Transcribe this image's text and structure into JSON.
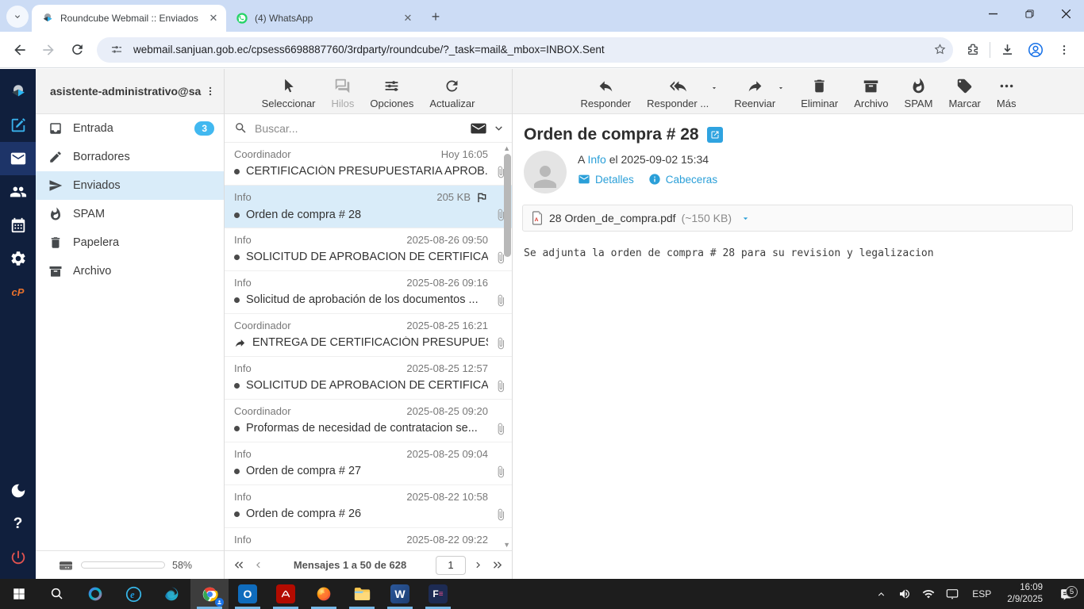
{
  "browser": {
    "tabs": [
      {
        "title": "Roundcube Webmail :: Enviados",
        "favicon": "roundcube",
        "active": true
      },
      {
        "title": "(4) WhatsApp",
        "favicon": "whatsapp",
        "active": false
      }
    ],
    "url": "webmail.sanjuan.gob.ec/cpsess6698887760/3rdparty/roundcube/?_task=mail&_mbox=INBOX.Sent"
  },
  "rail": {
    "items": [
      {
        "name": "roundcube-logo",
        "icon": "logo"
      },
      {
        "name": "compose",
        "icon": "pencil-square",
        "style": "compose"
      },
      {
        "name": "mail",
        "icon": "envelope",
        "active": true
      },
      {
        "name": "contacts",
        "icon": "people"
      },
      {
        "name": "calendar",
        "icon": "calendar"
      },
      {
        "name": "settings",
        "icon": "gear"
      },
      {
        "name": "cpanel",
        "icon": "cp-text",
        "style": "cpanel",
        "text": "cP"
      },
      {
        "name": "spacer"
      },
      {
        "name": "dark-mode",
        "icon": "moon"
      },
      {
        "name": "help",
        "icon": "question"
      },
      {
        "name": "logout",
        "icon": "power",
        "style": "logout"
      }
    ]
  },
  "sidebar": {
    "account": "asistente-administrativo@sa...",
    "folders": [
      {
        "label": "Entrada",
        "icon": "inbox",
        "badge": "3"
      },
      {
        "label": "Borradores",
        "icon": "pencil"
      },
      {
        "label": "Enviados",
        "icon": "send",
        "selected": true
      },
      {
        "label": "SPAM",
        "icon": "fire"
      },
      {
        "label": "Papelera",
        "icon": "trash"
      },
      {
        "label": "Archivo",
        "icon": "archivebox"
      }
    ],
    "storage_percent_label": "58%",
    "storage_percent_value": 58
  },
  "list_toolbar": {
    "buttons": [
      {
        "label": "Seleccionar",
        "icon": "cursor"
      },
      {
        "label": "Hilos",
        "icon": "threads",
        "disabled": true
      },
      {
        "label": "Opciones",
        "icon": "sliders"
      },
      {
        "label": "Actualizar",
        "icon": "refresh"
      }
    ],
    "search_placeholder": "Buscar..."
  },
  "message_list": {
    "messages": [
      {
        "sender": "Coordinador",
        "date": "Hoy 16:05",
        "subject": "CERTIFICACIÓN PRESUPUESTARIA APROB...",
        "attachment": true,
        "marker": "dot"
      },
      {
        "sender": "Info",
        "date": "205 KB",
        "subject": "Orden de compra # 28",
        "attachment": true,
        "marker": "dot",
        "selected": true,
        "flag": true
      },
      {
        "sender": "Info",
        "date": "2025-08-26 09:50",
        "subject": "SOLICITUD DE APROBACION DE CERTIFICA...",
        "attachment": true,
        "marker": "dot"
      },
      {
        "sender": "Info",
        "date": "2025-08-26 09:16",
        "subject": "Solicitud de aprobación de los documentos ...",
        "attachment": true,
        "marker": "dot"
      },
      {
        "sender": "Coordinador",
        "date": "2025-08-25 16:21",
        "subject": "ENTREGA DE CERTIFICACIÓN PRESUPUEST...",
        "attachment": true,
        "marker": "forward"
      },
      {
        "sender": "Info",
        "date": "2025-08-25 12:57",
        "subject": "SOLICITUD DE APROBACION DE CERTIFICA...",
        "attachment": true,
        "marker": "dot"
      },
      {
        "sender": "Coordinador",
        "date": "2025-08-25 09:20",
        "subject": "Proformas de necesidad de contratacion se...",
        "attachment": true,
        "marker": "dot"
      },
      {
        "sender": "Info",
        "date": "2025-08-25 09:04",
        "subject": "Orden de compra # 27",
        "attachment": true,
        "marker": "dot"
      },
      {
        "sender": "Info",
        "date": "2025-08-22 10:58",
        "subject": "Orden de compra # 26",
        "attachment": true,
        "marker": "dot"
      },
      {
        "sender": "Info",
        "date": "2025-08-22 09:22",
        "subject": "",
        "attachment": false,
        "marker": "none"
      }
    ],
    "pagination_text": "Mensajes 1 a 50 de 628",
    "page_value": "1"
  },
  "content": {
    "toolbar": [
      {
        "label": "Responder",
        "icon": "reply"
      },
      {
        "label": "Responder ...",
        "icon": "replyall",
        "caret": true
      },
      {
        "label": "Reenviar",
        "icon": "forward",
        "caret": true
      },
      {
        "label": "Eliminar",
        "icon": "trash"
      },
      {
        "label": "Archivo",
        "icon": "archivebox"
      },
      {
        "label": "SPAM",
        "icon": "fire"
      },
      {
        "label": "Marcar",
        "icon": "tag"
      },
      {
        "label": "Más",
        "icon": "more"
      }
    ],
    "subject": "Orden de compra # 28",
    "meta_prefix": "A",
    "meta_to": "Info",
    "meta_date": "el 2025-09-02 15:34",
    "details_label": "Detalles",
    "headers_label": "Cabeceras",
    "attachment_name": "28 Orden_de_compra.pdf",
    "attachment_size": "(~150 KB)",
    "body": "Se adjunta la orden de compra # 28 para su revision y legalizacion"
  },
  "taskbar": {
    "apps": [
      {
        "name": "start-button",
        "glyph": "start"
      },
      {
        "name": "search-button",
        "glyph": "search"
      },
      {
        "name": "copilot",
        "glyph": "copilot"
      },
      {
        "name": "internet-explorer",
        "glyph": "ie"
      },
      {
        "name": "edge",
        "glyph": "edge"
      },
      {
        "name": "chrome",
        "glyph": "chrome",
        "active": true,
        "running": true
      },
      {
        "name": "outlook",
        "glyph": "outlook",
        "running": true
      },
      {
        "name": "acrobat",
        "glyph": "acrobat",
        "running": true
      },
      {
        "name": "firefox",
        "glyph": "firefox",
        "running": true
      },
      {
        "name": "file-explorer",
        "glyph": "explorer",
        "running": true
      },
      {
        "name": "word",
        "glyph": "word",
        "running": true
      },
      {
        "name": "fes-app",
        "glyph": "fes",
        "running": true
      }
    ],
    "language": "ESP",
    "time": "16:09",
    "date": "2/9/2025",
    "notification_count": "5"
  }
}
